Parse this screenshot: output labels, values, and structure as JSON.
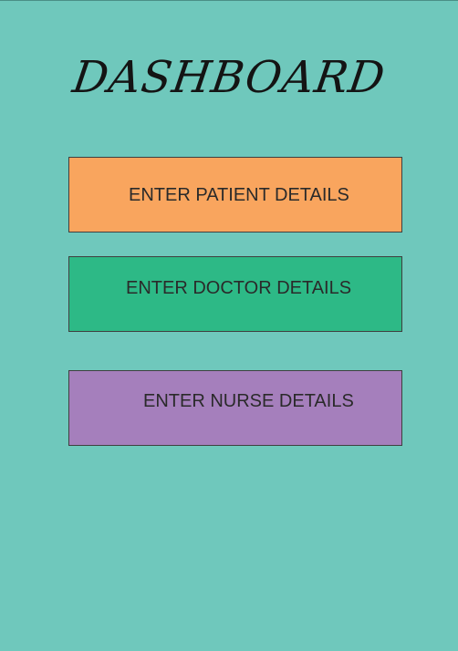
{
  "header": {
    "title": "DASHBOARD"
  },
  "actions": {
    "patient_label": "ENTER PATIENT DETAILS",
    "doctor_label": "ENTER DOCTOR DETAILS",
    "nurse_label": "ENTER NURSE DETAILS"
  },
  "colors": {
    "background": "#6fc8bc",
    "patient_button": "#f9a55e",
    "doctor_button": "#2db986",
    "nurse_button": "#a57fbc"
  }
}
